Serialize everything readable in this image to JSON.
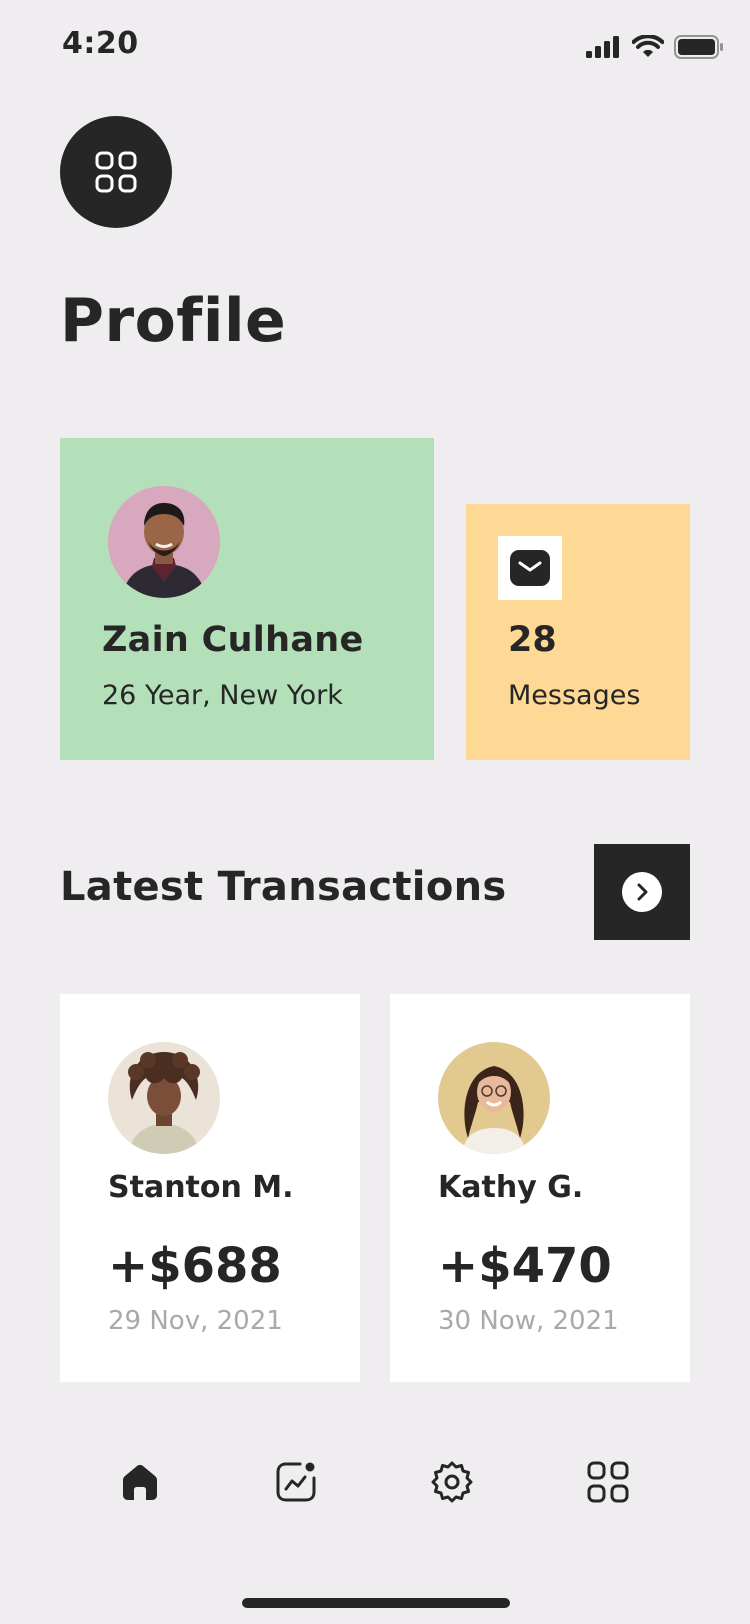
{
  "status_bar": {
    "time": "4:20",
    "icons": [
      "cellular-signal-icon",
      "wifi-icon",
      "battery-icon"
    ]
  },
  "header": {
    "menu_icon": "grid-icon",
    "title": "Profile"
  },
  "profile_card": {
    "name": "Zain Culhane",
    "meta": "26 Year, New York",
    "background": "#b3e0b9"
  },
  "messages_card": {
    "icon": "mail-icon",
    "count": "28",
    "label": "Messages",
    "background": "#fed995"
  },
  "transactions": {
    "title": "Latest Transactions",
    "next_icon": "chevron-right-icon",
    "items": [
      {
        "name": "Stanton M.",
        "amount": "+$688",
        "date": "29 Nov, 2021"
      },
      {
        "name": "Kathy G.",
        "amount": "+$470",
        "date": "30 Now, 2021"
      }
    ]
  },
  "bottom_nav": {
    "items": [
      {
        "icon": "home-icon",
        "active": true
      },
      {
        "icon": "analytics-icon",
        "active": false
      },
      {
        "icon": "settings-icon",
        "active": false
      },
      {
        "icon": "grid-icon",
        "active": false
      }
    ]
  },
  "colors": {
    "dark": "#262626",
    "page_bg": "#efedf0",
    "muted_text": "#a9a9a9"
  }
}
